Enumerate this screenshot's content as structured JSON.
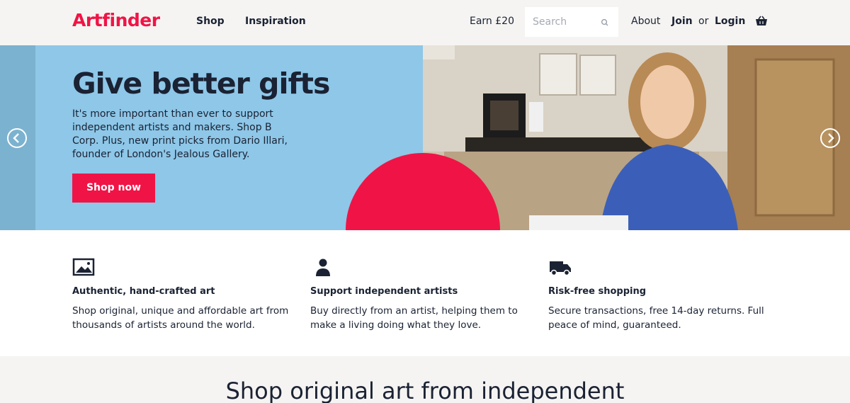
{
  "header": {
    "logo": "Artfinder",
    "nav": {
      "shop": "Shop",
      "inspiration": "Inspiration"
    },
    "earn": "Earn £20",
    "search_placeholder": "Search",
    "about": "About",
    "join": "Join",
    "or": "or",
    "login": "Login"
  },
  "hero": {
    "title": "Give better gifts",
    "text": "It's more important than ever to support independent artists and makers. Shop B Corp. Plus, new print picks from Dario Illari, founder of London's Jealous Gallery.",
    "button": "Shop now"
  },
  "features": [
    {
      "icon": "image-icon",
      "title": "Authentic, hand-crafted art",
      "text": "Shop original, unique and affordable art from thousands of artists around the world."
    },
    {
      "icon": "person-icon",
      "title": "Support independent artists",
      "text": "Buy directly from an artist, helping them to make a living doing what they love."
    },
    {
      "icon": "truck-icon",
      "title": "Risk-free shopping",
      "text": "Secure transactions, free 14-day returns. Full peace of mind, guaranteed."
    }
  ],
  "section_title": "Shop original art from independent",
  "colors": {
    "brand": "#f01446",
    "hero_blue": "#8ec7e8",
    "text": "#1a2233"
  }
}
